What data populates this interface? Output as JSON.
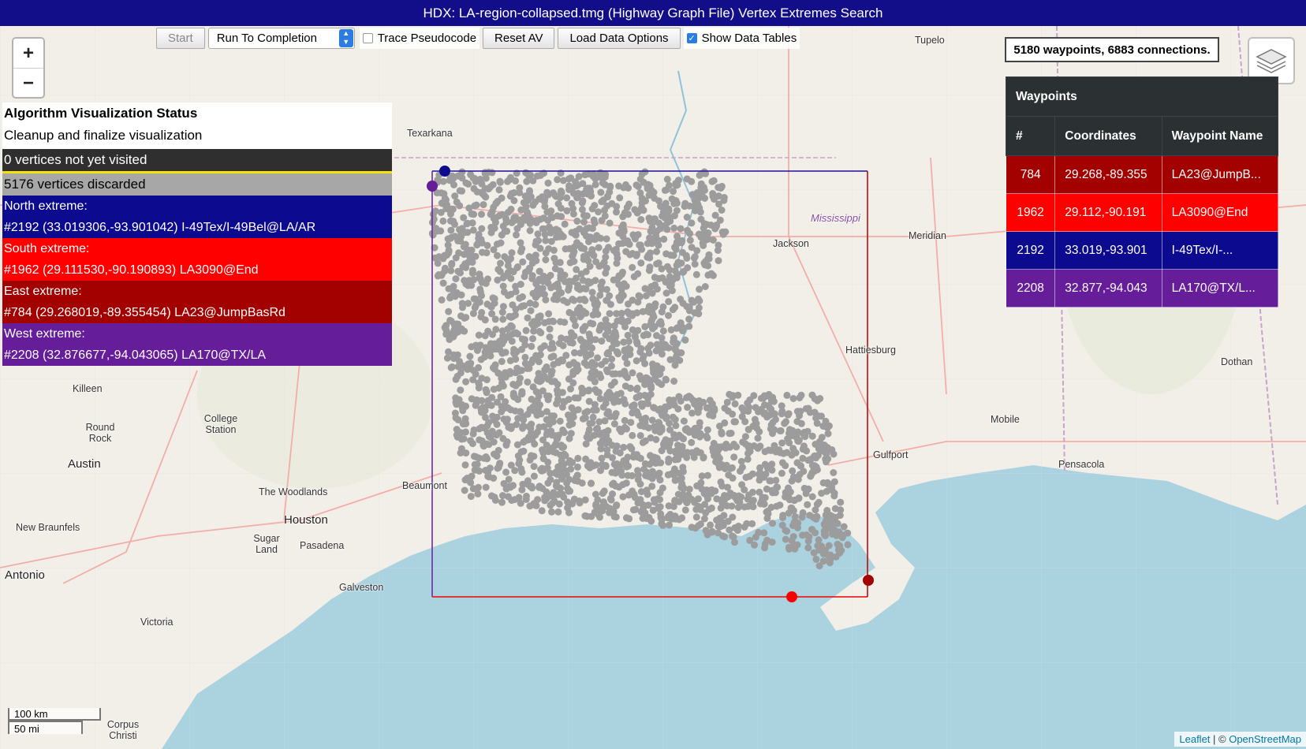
{
  "window": {
    "title": "HDX: LA-region-collapsed.tmg (Highway Graph File) Vertex Extremes Search"
  },
  "toolbar": {
    "start_label": "Start",
    "run_mode": "Run To Completion",
    "trace_label": "Trace Pseudocode",
    "reset_label": "Reset AV",
    "load_label": "Load Data Options",
    "show_tables_label": "Show Data Tables",
    "show_tables_checked": true,
    "trace_checked": false
  },
  "zoom": {
    "in": "+",
    "out": "−"
  },
  "status": {
    "title": "Algorithm Visualization Status",
    "message": "Cleanup and finalize visualization",
    "not_visited": "0 vertices not yet visited",
    "discarded": "5176 vertices discarded",
    "extremes": [
      {
        "label": "North extreme:",
        "detail": "#2192 (33.019306,-93.901042) I-49Tex/I-49Bel@LA/AR",
        "color": "#0c0a8e"
      },
      {
        "label": "South extreme:",
        "detail": "#1962 (29.111530,-90.190893) LA3090@End",
        "color": "#ff0000"
      },
      {
        "label": "East extreme:",
        "detail": "#784 (29.268019,-89.355454) LA23@JumpBasRd",
        "color": "#a30000"
      },
      {
        "label": "West extreme:",
        "detail": "#2208 (32.876677,-94.043065) LA170@TX/LA",
        "color": "#651d9a"
      }
    ]
  },
  "info": {
    "summary": "5180 waypoints, 6883 connections."
  },
  "waypoints_table": {
    "caption": "Waypoints",
    "headers": [
      "#",
      "Coordinates",
      "Waypoint Name"
    ],
    "rows": [
      {
        "num": "784",
        "coords": "29.268,-89.355",
        "name": "LA23@JumpB...",
        "color": "#a30000"
      },
      {
        "num": "1962",
        "coords": "29.112,-90.191",
        "name": "LA3090@End",
        "color": "#ff0000"
      },
      {
        "num": "2192",
        "coords": "33.019,-93.901",
        "name": "I-49Tex/I-...",
        "color": "#0c0a8e"
      },
      {
        "num": "2208",
        "coords": "32.877,-94.043",
        "name": "LA170@TX/L...",
        "color": "#651d9a"
      }
    ]
  },
  "map_labels": {
    "texarkana": "Texarkana",
    "tupelo": "Tupelo",
    "jackson": "Jackson",
    "meridian": "Meridian",
    "mississippi": "Mississippi",
    "hattiesburg": "Hattiesburg",
    "dothan": "Dothan",
    "mobile": "Mobile",
    "gulfport": "Gulfport",
    "pensacola": "Pensacola",
    "killeen": "Killeen",
    "round_rock": "Round\nRock",
    "austin": "Austin",
    "college_station": "College\nStation",
    "beaumont": "Beaumont",
    "the_woodlands": "The Woodlands",
    "houston": "Houston",
    "new_braunfels": "New Braunfels",
    "sugar_land": "Sugar\nLand",
    "pasadena": "Pasadena",
    "antonio": "Antonio",
    "galveston": "Galveston",
    "victoria": "Victoria",
    "corpus_christi": "Corpus\nChristi"
  },
  "scale": {
    "km": "100 km",
    "mi": "50 mi"
  },
  "attribution": {
    "leaflet": "Leaflet",
    "sep": " | © ",
    "osm": "OpenStreetMap"
  }
}
